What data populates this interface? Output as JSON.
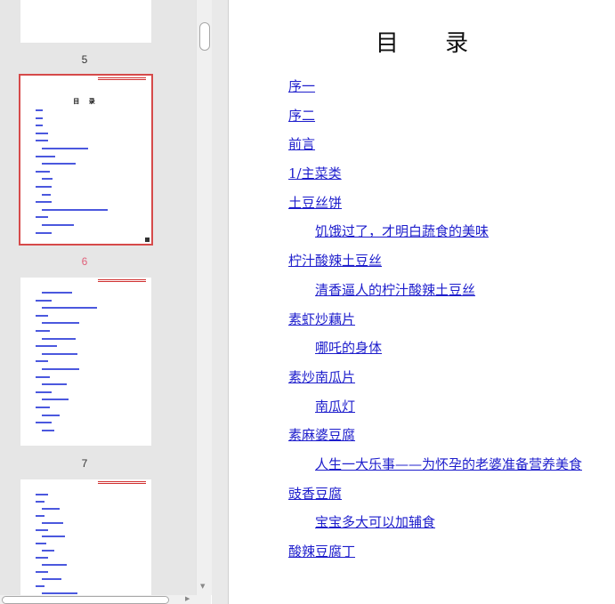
{
  "thumbnails": {
    "pages": [
      {
        "number": "5"
      },
      {
        "number": "6"
      },
      {
        "number": "7"
      }
    ],
    "selected_title": "目  录"
  },
  "document": {
    "title": "目 录",
    "toc": [
      {
        "label": "序一",
        "level": 1
      },
      {
        "label": "序二",
        "level": 1
      },
      {
        "label": "前言",
        "level": 1
      },
      {
        "label": "1/主菜类",
        "level": 1
      },
      {
        "label": "土豆丝饼",
        "level": 1
      },
      {
        "label": "饥饿过了，才明白蔬食的美味",
        "level": 2
      },
      {
        "label": "柠汁酸辣土豆丝",
        "level": 1
      },
      {
        "label": "清香逼人的柠汁酸辣土豆丝",
        "level": 2
      },
      {
        "label": "素虾炒藕片",
        "level": 1
      },
      {
        "label": "哪吒的身体",
        "level": 2
      },
      {
        "label": "素炒南瓜片",
        "level": 1
      },
      {
        "label": "南瓜灯",
        "level": 2
      },
      {
        "label": "素麻婆豆腐",
        "level": 1
      },
      {
        "label": "人生一大乐事——为怀孕的老婆准备营养美食",
        "level": 2
      },
      {
        "label": "豉香豆腐",
        "level": 1
      },
      {
        "label": "宝宝多大可以加辅食",
        "level": 2
      },
      {
        "label": "酸辣豆腐丁",
        "level": 1
      }
    ]
  },
  "colors": {
    "link": "#1d1dcc",
    "selected_outline": "#d64a4a",
    "active_page_number": "#e0607a"
  }
}
